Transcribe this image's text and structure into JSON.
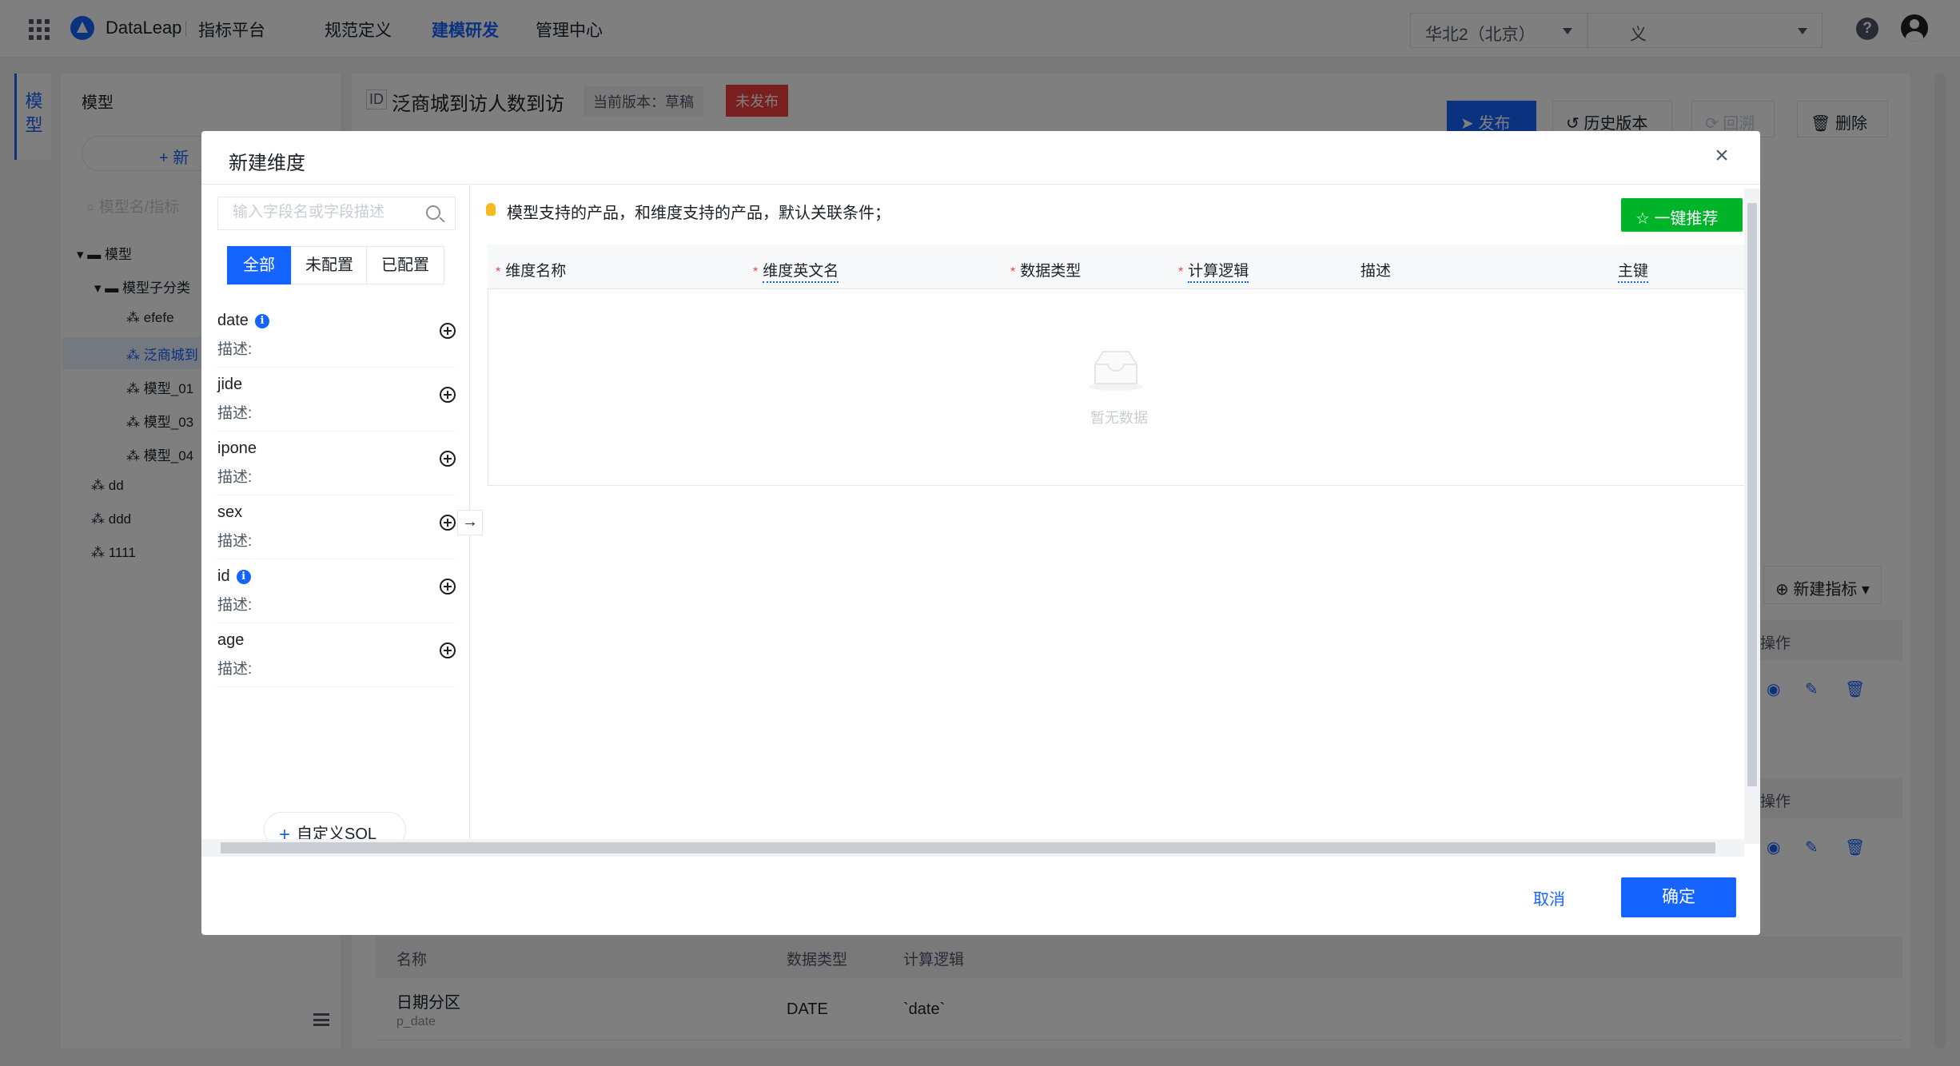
{
  "nav": {
    "brand": "DataLeap",
    "platform": "指标平台",
    "items": [
      "规范定义",
      "建模研发",
      "管理中心"
    ],
    "region": "华北2（北京）",
    "project": "义"
  },
  "left": {
    "vertical_tab": "模型",
    "title": "模型",
    "new_button": "新",
    "search_placeholder": "模型名/指标",
    "tree": [
      "模型",
      "模型子分类",
      "efefe",
      "泛商城到",
      "模型_01",
      "模型_03",
      "模型_04",
      "dd",
      "ddd",
      "1111"
    ]
  },
  "main": {
    "id_badge": "ID",
    "title": "泛商城到访人数到访",
    "version": "当前版本：草稿",
    "status": "未发布",
    "buttons": {
      "publish": "发布",
      "history": "历史版本",
      "rollback": "回溯",
      "delete": "删除"
    },
    "new_metric": "新建指标",
    "op_header": "操作",
    "bottom_table": {
      "headers": [
        "名称",
        "数据类型",
        "计算逻辑"
      ],
      "row": {
        "name": "日期分区",
        "sub": "p_date",
        "type": "DATE",
        "logic": "`date`"
      }
    }
  },
  "modal": {
    "title": "新建维度",
    "search_placeholder": "输入字段名或字段描述",
    "segments": [
      "全部",
      "未配置",
      "已配置"
    ],
    "desc_label": "描述:",
    "fields": [
      {
        "name": "date",
        "info": true
      },
      {
        "name": "jide",
        "info": false
      },
      {
        "name": "ipone",
        "info": false
      },
      {
        "name": "sex",
        "info": false
      },
      {
        "name": "id",
        "info": true
      },
      {
        "name": "age",
        "info": false
      }
    ],
    "info_glyph": "i",
    "transfer_arrow": "→",
    "custom_sql": "自定义SQL",
    "tip": "模型支持的产品，和维度支持的产品，默认关联条件；",
    "recommend": "一键推荐",
    "columns": [
      "维度名称",
      "维度英文名",
      "数据类型",
      "计算逻辑",
      "描述",
      "主键"
    ],
    "empty": "暂无数据",
    "cancel": "取消",
    "confirm": "确定"
  }
}
